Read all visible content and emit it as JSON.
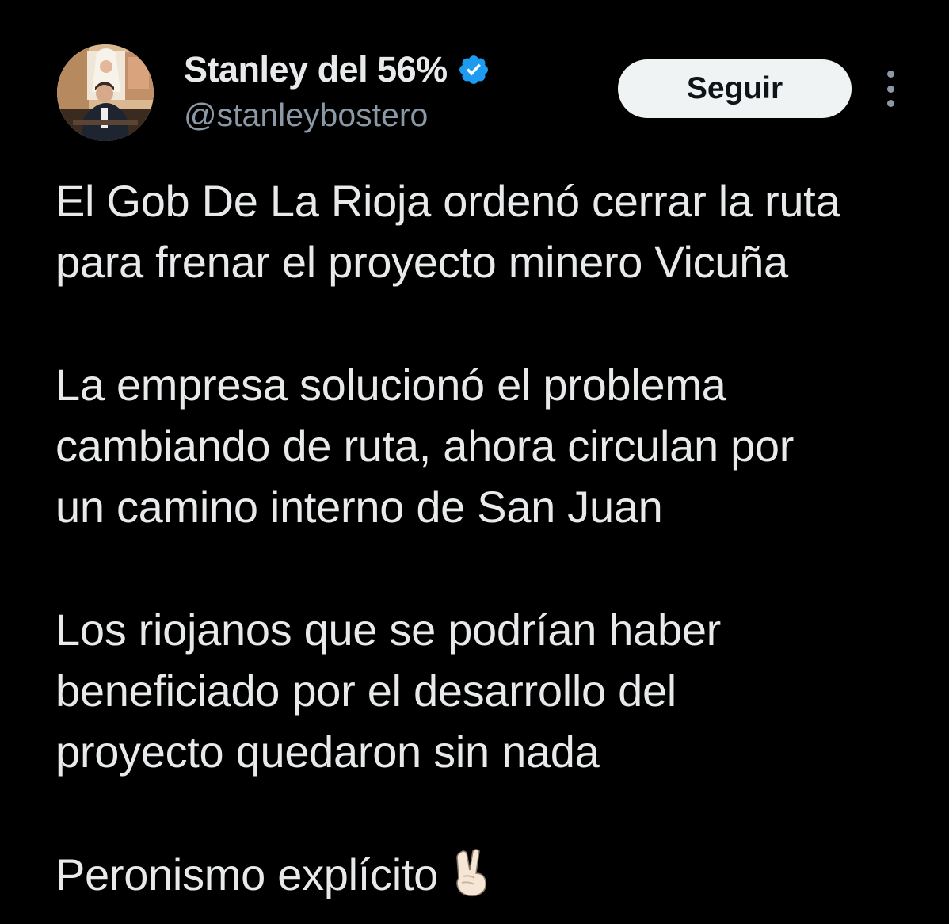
{
  "author": {
    "display_name": "Stanley del 56%",
    "handle": "@stanleybostero",
    "verified_badge_icon": "verified-badge-icon",
    "verified_badge_color": "#1d9bf0"
  },
  "actions": {
    "follow_label": "Seguir",
    "more_icon": "more-vertical-icon"
  },
  "tweet": {
    "paragraphs": [
      {
        "lines": [
          "El Gob De La Rioja ordenó cerrar la ruta",
          "para frenar el proyecto minero Vicuña"
        ]
      },
      {
        "lines": [
          "La empresa solucionó el problema",
          "cambiando de ruta, ahora circulan por",
          "un camino interno de San Juan"
        ]
      },
      {
        "lines": [
          "Los riojanos que se podrían haber",
          "beneficiado por el desarrollo del",
          "proyecto quedaron sin nada"
        ]
      },
      {
        "lines": [
          "Peronismo explícito"
        ],
        "emoji": "victory-hand-icon"
      }
    ]
  },
  "colors": {
    "background": "#000000",
    "text_primary": "#e7e9ea",
    "text_secondary": "#8b98a5",
    "button_bg": "#eff3f4",
    "button_text": "#0f1419"
  }
}
